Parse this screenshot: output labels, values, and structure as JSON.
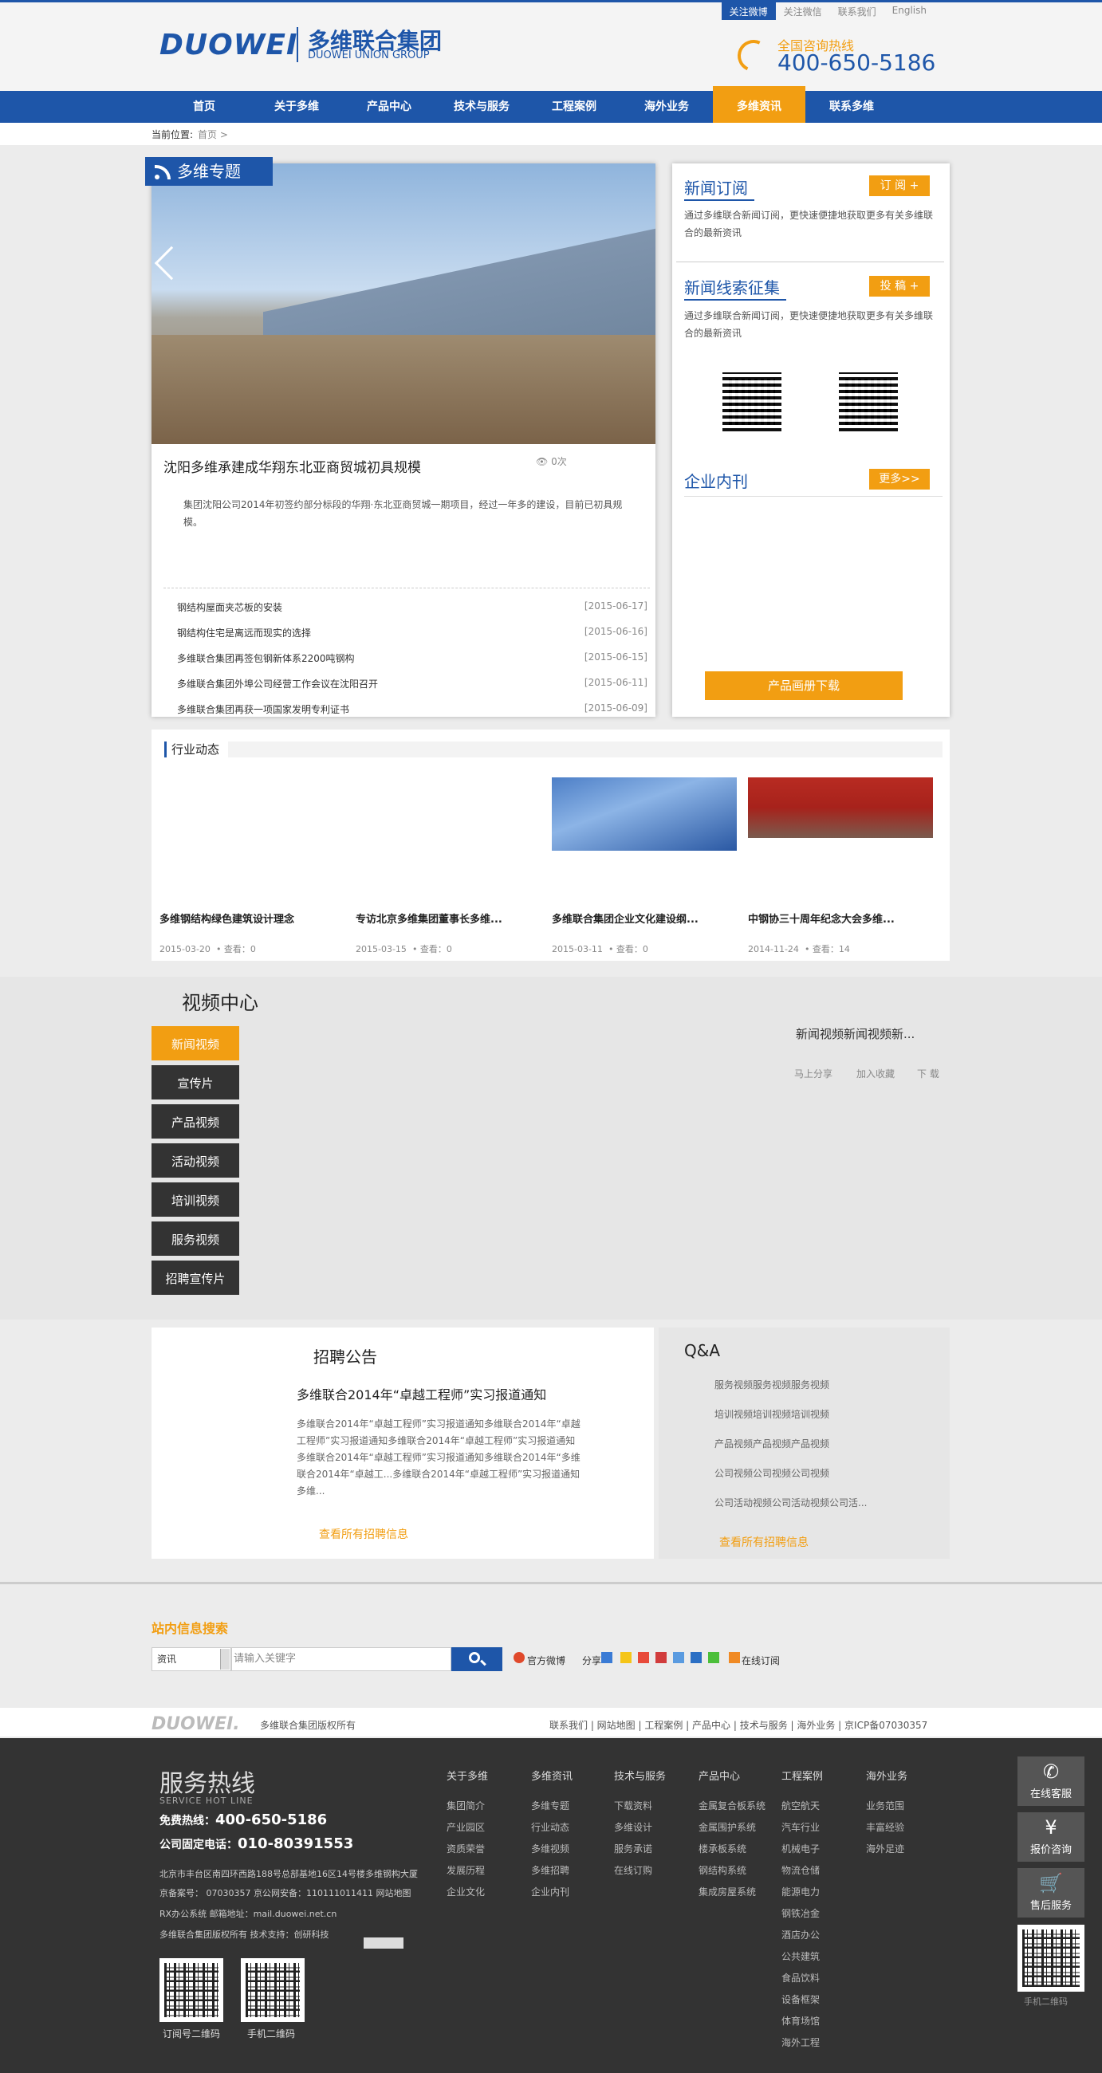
{
  "top_links": [
    "关注微博",
    "关注微信",
    "联系我们",
    "English"
  ],
  "logo": {
    "en": "DUOWEI",
    "cn": "多维联合集团",
    "en_sub": "DUOWEI UNION GROUP"
  },
  "hotline": {
    "caption": "全国咨询热线",
    "number": "400-650-5186"
  },
  "nav": [
    "首页",
    "关于多维",
    "产品中心",
    "技术与服务",
    "工程案例",
    "海外业务",
    "多维资讯",
    "联系多维"
  ],
  "breadcrumb": {
    "label": "当前位置:",
    "home": "首页 >"
  },
  "topic": {
    "tag": "多维专题",
    "title": "沈阳多维承建成华翔东北亚商贸城初具规模",
    "views": "0次",
    "desc": "集团沈阳公司2014年初签约部分标段的华翔·东北亚商贸城一期项目，经过一年多的建设，目前已初具规模。",
    "news": [
      {
        "t": "钢结构屋面夹芯板的安装",
        "d": "[2015-06-17]"
      },
      {
        "t": "钢结构住宅是离远而现实的选择",
        "d": "[2015-06-16]"
      },
      {
        "t": "多维联合集团再签包钢新体系2200吨钢构",
        "d": "[2015-06-15]"
      },
      {
        "t": "多维联合集团外埠公司经营工作会议在沈阳召开",
        "d": "[2015-06-11]"
      },
      {
        "t": "多维联合集团再获一项国家发明专利证书",
        "d": "[2015-06-09]"
      }
    ]
  },
  "right": {
    "sub_title": "新闻订阅",
    "sub_btn": "订 阅 +",
    "sub_txt": "通过多维联合新闻订阅，更快速便捷地获取更多有关多维联合的最新资讯",
    "clue_title": "新闻线索征集",
    "clue_btn": "投 稿 +",
    "clue_txt": "通过多维联合新闻订阅，更快速便捷地获取更多有关多维联合的最新资讯",
    "mag_title": "企业内刊",
    "mag_btn": "更多>>",
    "download": "产品画册下载"
  },
  "industry": {
    "title": "行业动态",
    "items": [
      {
        "t": "多维钢结构绿色建筑设计理念",
        "d": "2015-03-20",
        "v": "• 查看：0"
      },
      {
        "t": "专访北京多维集团董事长多维...",
        "d": "2015-03-15",
        "v": "• 查看：0"
      },
      {
        "t": "多维联合集团企业文化建设纲...",
        "d": "2015-03-11",
        "v": "• 查看：0"
      },
      {
        "t": "中钢协三十周年纪念大会多维...",
        "d": "2014-11-24",
        "v": "• 查看：14"
      }
    ]
  },
  "video": {
    "title": "视频中心",
    "tabs": [
      "新闻视频",
      "宣传片",
      "产品视频",
      "活动视频",
      "培训视频",
      "服务视频",
      "招聘宣传片"
    ],
    "caption": "新闻视频新闻视频新...",
    "actions": [
      "马上分享",
      "加入收藏",
      "下 载"
    ]
  },
  "recruit": {
    "title": "招聘公告",
    "headline": "多维联合2014年“卓越工程师”实习报道通知",
    "desc": "多维联合2014年“卓越工程师”实习报道通知多维联合2014年“卓越工程师”实习报道通知多维联合2014年“卓越工程师”实习报道通知多维联合2014年“卓越工程师”实习报道通知多维联合2014年“多维联合2014年“卓越工...多维联合2014年“卓越工程师”实习报道通知多维...",
    "more": "查看所有招聘信息"
  },
  "qa": {
    "title": "Q&A",
    "items": [
      "服务视频服务视频服务视频",
      "培训视频培训视频培训视频",
      "产品视频产品视频产品视频",
      "公司视频公司视频公司视频",
      "公司活动视频公司活动视频公司活..."
    ],
    "more": "查看所有招聘信息"
  },
  "search": {
    "title": "站内信息搜索",
    "select": "资讯",
    "placeholder": "请输入关键字",
    "weibo": "官方微博",
    "share": "分享",
    "subscribe": "在线订阅"
  },
  "footbar": {
    "logo": "DUOWEI.",
    "copy": "多维联合集团版权所有",
    "links": "联系我们 | 网站地图 | 工程案例 | 产品中心 | 技术与服务 | 海外业务 | 京ICP备07030357"
  },
  "footer": {
    "hl_title": "服务热线",
    "hl_en": "SERVICE HOT LINE",
    "free_label": "免费热线：",
    "free": "400-650-5186",
    "fixed_label": "公司固定电话：",
    "fixed": "010-80391553",
    "addr": "北京市丰台区南四环西路188号总部基地16区14号楼多维钢构大厦",
    "icp": "京备案号：  07030357  京公网安备：110111011411  网站地图",
    "mail": "RX办公系统  邮箱地址：mail.duowei.net.cn",
    "tech": "多维联合集团版权所有  技术支持：创研科技",
    "qr1": "订阅号二维码",
    "qr2": "手机二维码",
    "cols": [
      {
        "h": "关于多维",
        "items": [
          "集团简介",
          "产业园区",
          "资质荣誉",
          "发展历程",
          "企业文化"
        ]
      },
      {
        "h": "多维资讯",
        "items": [
          "多维专题",
          "行业动态",
          "多维视频",
          "多维招聘",
          "企业内刊"
        ]
      },
      {
        "h": "技术与服务",
        "items": [
          "下载资料",
          "多维设计",
          "服务承诺",
          "在线订购"
        ]
      },
      {
        "h": "产品中心",
        "items": [
          "金属复合板系统",
          "金属围护系统",
          "楼承板系统",
          "钢结构系统",
          "集成房屋系统"
        ]
      },
      {
        "h": "工程案例",
        "items": [
          "航空航天",
          "汽车行业",
          "机械电子",
          "物流仓储",
          "能源电力",
          "钢铁冶金",
          "酒店办公",
          "公共建筑",
          "食品饮料",
          "设备框架",
          "体育场馆",
          "海外工程"
        ]
      },
      {
        "h": "海外业务",
        "items": [
          "业务范围",
          "丰富经验",
          "海外足迹"
        ]
      }
    ],
    "side": [
      {
        "ic": "✆",
        "t": "在线客服"
      },
      {
        "ic": "¥",
        "t": "报价咨询"
      },
      {
        "ic": "🛒",
        "t": "售后服务"
      }
    ],
    "side_qr": "手机二维码"
  }
}
